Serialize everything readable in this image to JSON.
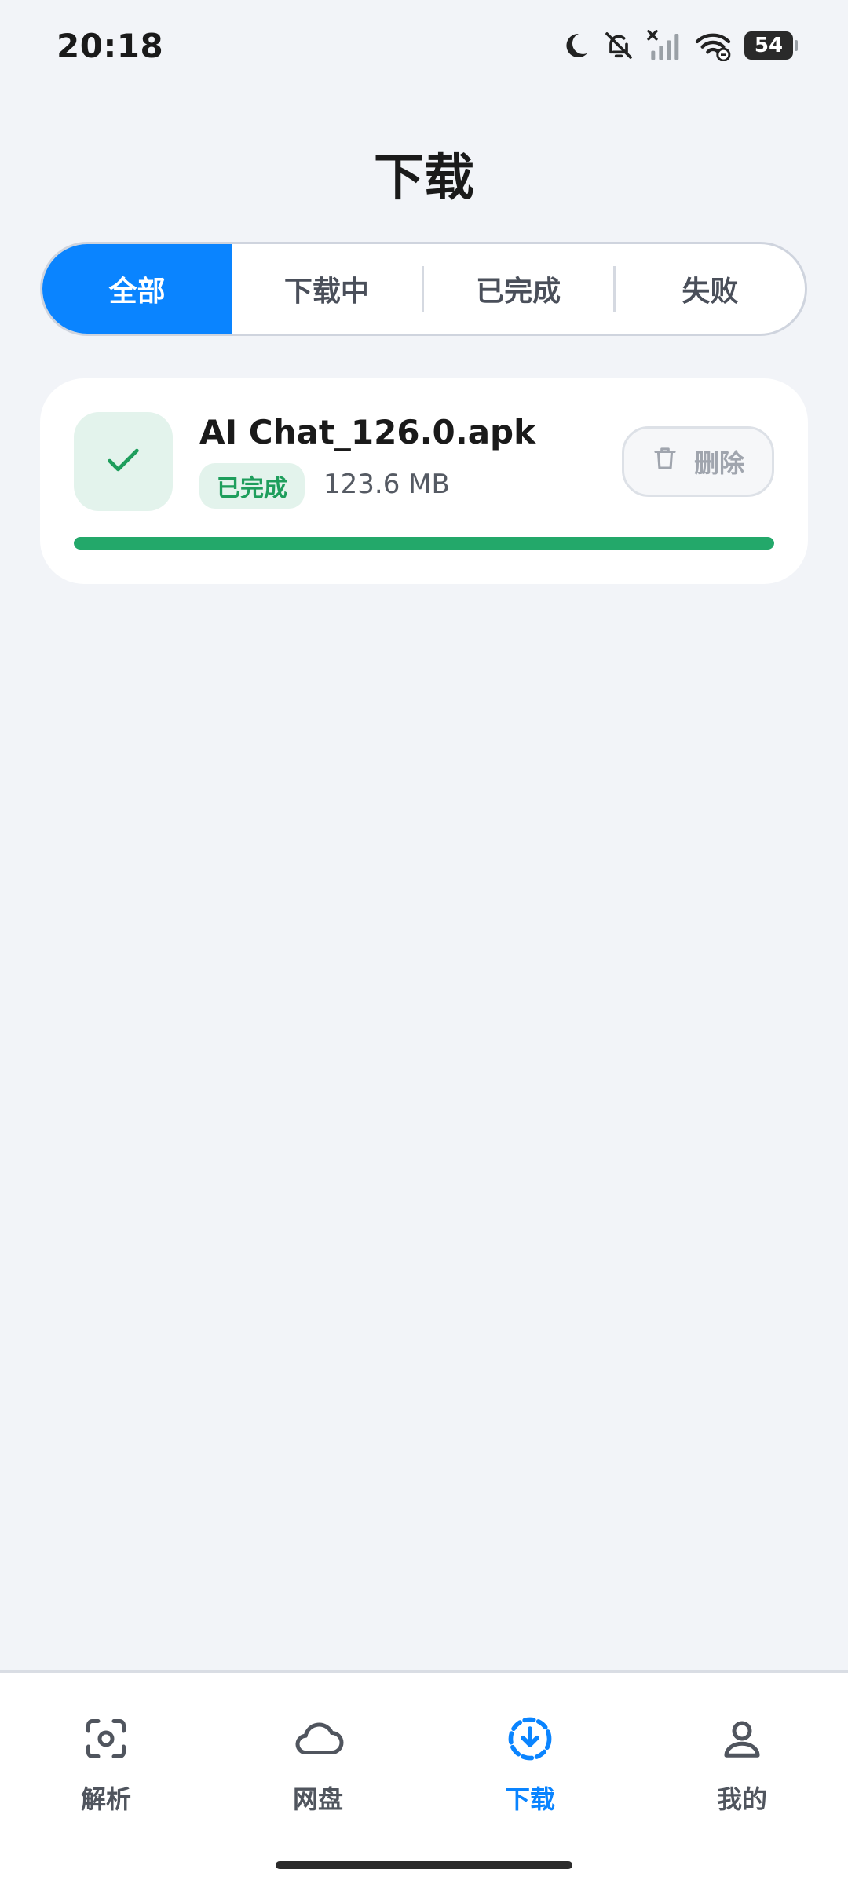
{
  "status_bar": {
    "time": "20:18",
    "battery": "54",
    "icons": [
      "moon-icon",
      "mute-icon",
      "signal-off-icon",
      "wifi-icon",
      "battery-icon"
    ]
  },
  "page": {
    "title": "下载"
  },
  "tabs": [
    {
      "label": "全部",
      "active": true
    },
    {
      "label": "下载中",
      "active": false
    },
    {
      "label": "已完成",
      "active": false
    },
    {
      "label": "失败",
      "active": false
    }
  ],
  "downloads": [
    {
      "name": "AI Chat_126.0.apk",
      "status": "已完成",
      "size": "123.6 MB",
      "progress": 1.0,
      "delete_label": "删除",
      "icon": "check-icon"
    }
  ],
  "bottom_nav": [
    {
      "label": "解析",
      "icon": "scan-icon",
      "active": false
    },
    {
      "label": "网盘",
      "icon": "cloud-icon",
      "active": false
    },
    {
      "label": "下载",
      "icon": "download-icon",
      "active": true
    },
    {
      "label": "我的",
      "icon": "user-icon",
      "active": false
    }
  ],
  "colors": {
    "accent": "#0A84FF",
    "success": "#23A86A",
    "success_bg": "#E3F3EC",
    "background": "#F2F4F8"
  }
}
